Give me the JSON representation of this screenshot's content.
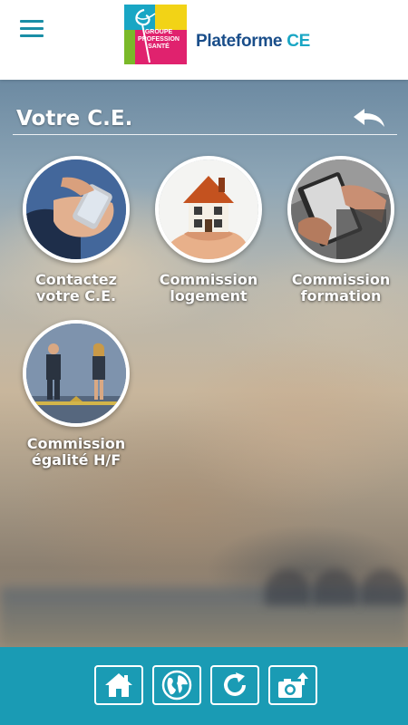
{
  "header": {
    "menu_icon": "hamburger-menu-icon",
    "logo_lines": [
      "GROUPE",
      "PROFESSION",
      "SANTÉ"
    ],
    "brand": {
      "word1": "Plateforme",
      "word2": "CE"
    },
    "colors": {
      "logo_pink": "#e0226e",
      "logo_green": "#7ab929",
      "logo_yellow": "#f2d316",
      "logo_cyan": "#19a6c4",
      "brand_blue": "#1a4e8a"
    }
  },
  "page": {
    "title": "Votre C.E.",
    "back_icon": "back-arrow-icon"
  },
  "tiles": [
    {
      "line1": "Contactez",
      "line2": "votre C.E.",
      "image": "hand-smartphone-photo"
    },
    {
      "line1": "Commission",
      "line2": "logement",
      "image": "house-in-hand-photo"
    },
    {
      "line1": "Commission",
      "line2": "formation",
      "image": "notebook-writing-photo"
    },
    {
      "line1": "Commission",
      "line2": "égalité H/F",
      "image": "man-woman-scale-photo"
    }
  ],
  "footer": {
    "buttons": [
      "home-icon",
      "globe-icon",
      "refresh-icon",
      "camera-upload-icon"
    ],
    "color": "#1a9bb4"
  }
}
